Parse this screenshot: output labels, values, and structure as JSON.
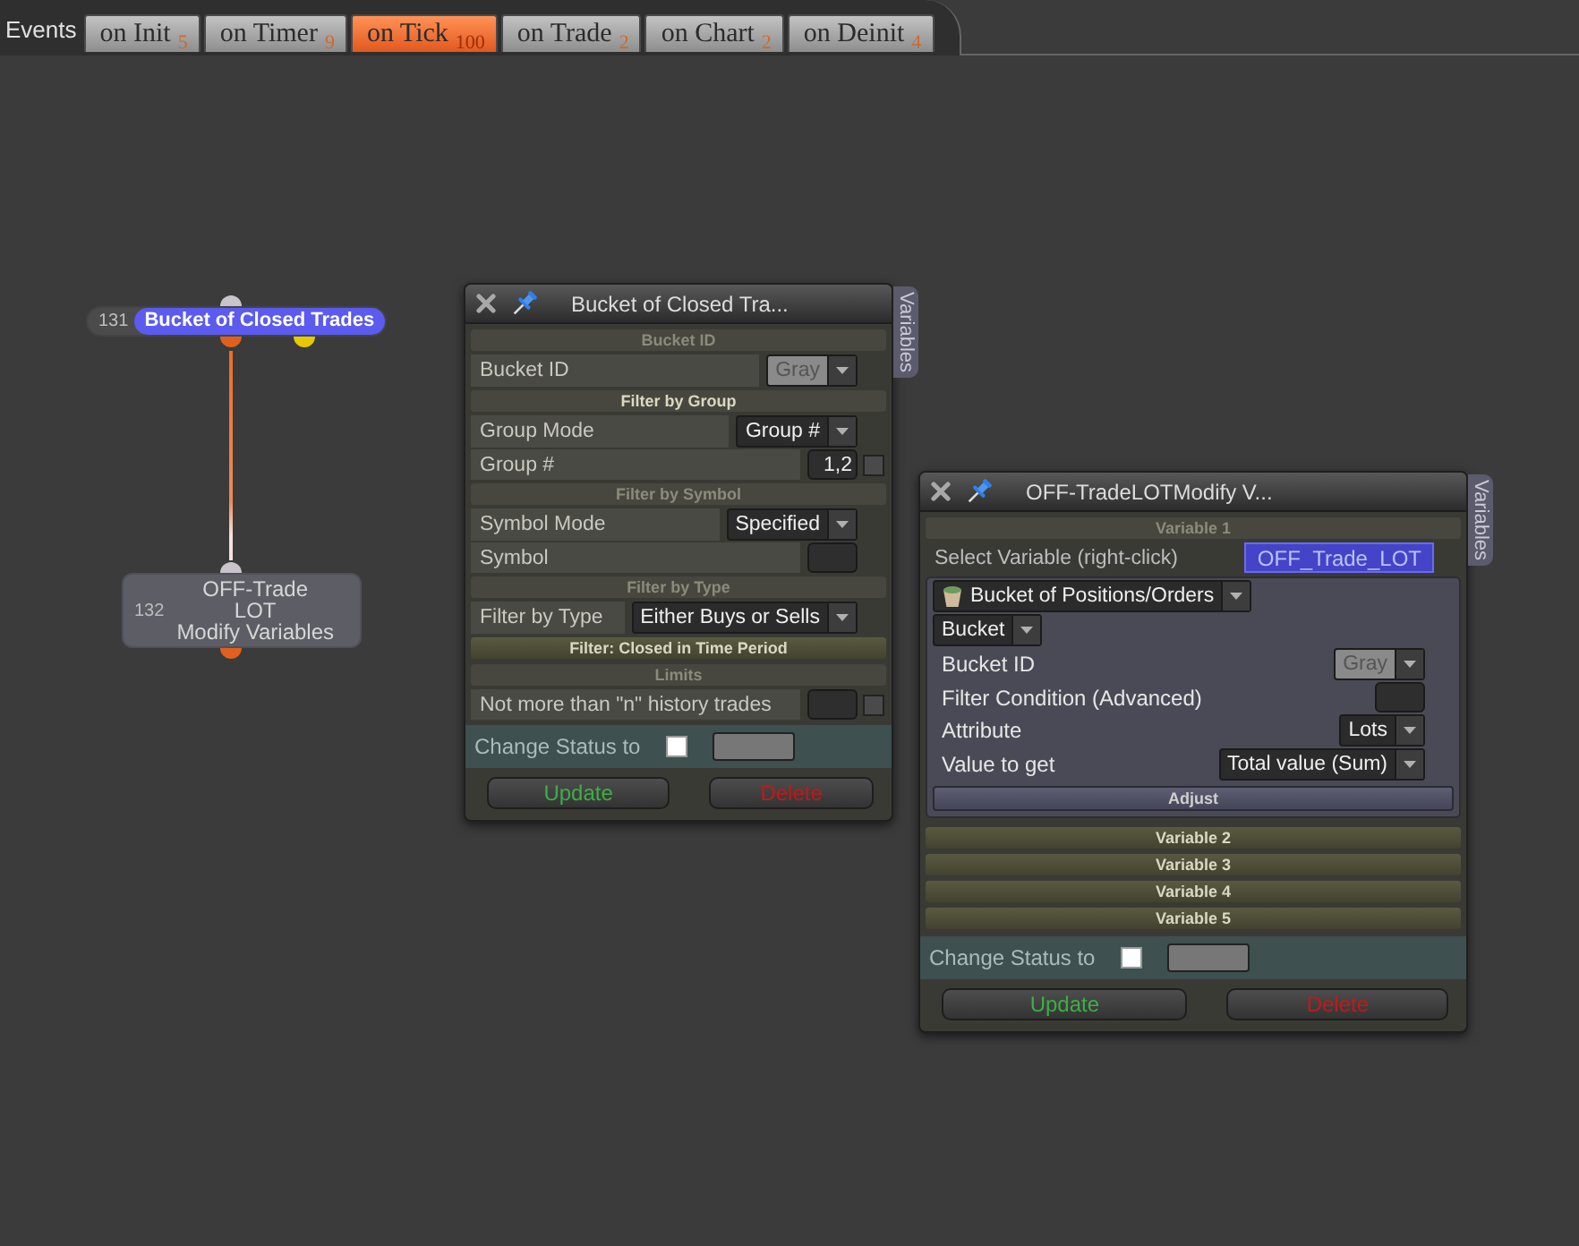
{
  "event_bar": {
    "label": "Events",
    "tabs": [
      {
        "label": "on Init",
        "count": "5",
        "selected": false
      },
      {
        "label": "on Timer",
        "count": "9",
        "selected": false
      },
      {
        "label": "on Tick",
        "count": "100",
        "selected": true
      },
      {
        "label": "on Trade",
        "count": "2",
        "selected": false
      },
      {
        "label": "on Chart",
        "count": "2",
        "selected": false
      },
      {
        "label": "on Deinit",
        "count": "4",
        "selected": false
      }
    ]
  },
  "nodes": [
    {
      "number": "131",
      "title_lines": [
        "Bucket of Closed Trades"
      ],
      "selected": true,
      "side_output": true
    },
    {
      "number": "132",
      "title_lines": [
        "OFF-Trade",
        "LOT",
        "Modify Variables"
      ],
      "selected": false,
      "side_output": false
    }
  ],
  "panels": [
    {
      "title": "Bucket of Closed Tra...",
      "side_tab": "Variables",
      "sections": [
        {
          "title": "Bucket ID",
          "expanded": true,
          "highlighted": false,
          "rows": [
            {
              "kind": "dropdown",
              "label": "Bucket ID",
              "value": "Gray",
              "disabled": true
            }
          ]
        },
        {
          "title": "Filter by Group",
          "expanded": true,
          "highlighted": true,
          "rows": [
            {
              "kind": "dropdown",
              "label": "Group Mode",
              "value": "Group #",
              "disabled": false
            },
            {
              "kind": "field_check",
              "label": "Group #",
              "value": "1,2",
              "checked": false
            }
          ]
        },
        {
          "title": "Filter by Symbol",
          "expanded": true,
          "highlighted": false,
          "rows": [
            {
              "kind": "dropdown",
              "label": "Symbol Mode",
              "value": "Specified",
              "disabled": false
            },
            {
              "kind": "field",
              "label": "Symbol"
            }
          ]
        },
        {
          "title": "Filter by Type",
          "expanded": true,
          "highlighted": false,
          "rows": [
            {
              "kind": "dropdown",
              "label": "Filter by Type",
              "value": "Either Buys or Sells",
              "disabled": false
            }
          ]
        },
        {
          "title": "Filter: Closed in Time Period",
          "expanded": false,
          "highlighted": true
        },
        {
          "title": "Limits",
          "expanded": true,
          "highlighted": false,
          "rows": [
            {
              "kind": "field_check",
              "label": "Not more than \"n\" history trades",
              "checked": false
            }
          ]
        }
      ],
      "status": {
        "label": "Change Status to",
        "checked": false
      },
      "buttons": [
        {
          "label": "Update",
          "kind": "update"
        },
        {
          "label": "Delete",
          "kind": "delete"
        }
      ]
    },
    {
      "title": "OFF-TradeLOTModify V...",
      "side_tab": "Variables",
      "sections": [
        {
          "title": "Variable 1",
          "expanded": true,
          "highlighted": false,
          "rows": [
            {
              "kind": "chip",
              "label": "Select Variable (right-click)",
              "value": "OFF_Trade_LOT"
            },
            {
              "kind": "group",
              "rows": [
                {
                  "kind": "icon_dropdown",
                  "value": "Bucket of Positions/Orders",
                  "disabled": false
                },
                {
                  "kind": "dropdown",
                  "value": "Bucket",
                  "disabled": false
                },
                {
                  "kind": "dropdown",
                  "label": "Bucket ID",
                  "value": "Gray",
                  "disabled": true
                },
                {
                  "kind": "field",
                  "label": "Filter Condition (Advanced)"
                },
                {
                  "kind": "dropdown",
                  "label": "Attribute",
                  "value": "Lots",
                  "disabled": false
                },
                {
                  "kind": "dropdown",
                  "label": "Value to get",
                  "value": "Total value (Sum)",
                  "disabled": false
                },
                {
                  "kind": "button",
                  "label": "Adjust"
                }
              ]
            }
          ]
        },
        {
          "title": "Variable 2",
          "expanded": false,
          "highlighted": true
        },
        {
          "title": "Variable 3",
          "expanded": false,
          "highlighted": true
        },
        {
          "title": "Variable 4",
          "expanded": false,
          "highlighted": true
        },
        {
          "title": "Variable 5",
          "expanded": false,
          "highlighted": true
        }
      ],
      "status": {
        "label": "Change Status to",
        "checked": false
      },
      "buttons": [
        {
          "label": "Update",
          "kind": "update"
        },
        {
          "label": "Delete",
          "kind": "delete"
        }
      ]
    }
  ]
}
